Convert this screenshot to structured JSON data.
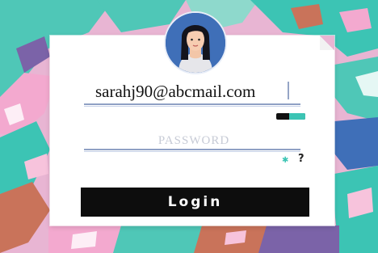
{
  "login": {
    "email_value": "sarahj90@abcmail.com",
    "password_placeholder": "PASSWORD",
    "reveal_glyph": "✱",
    "help_label": "?",
    "login_label": "Login"
  },
  "avatar": {
    "icon": "user-avatar"
  },
  "colors": {
    "background": "#e8b5d3",
    "teal": "#3cc4b4",
    "button": "#0d0d0d",
    "avatar_bg": "#3f6fb8",
    "underline": "#8fa0c4"
  }
}
